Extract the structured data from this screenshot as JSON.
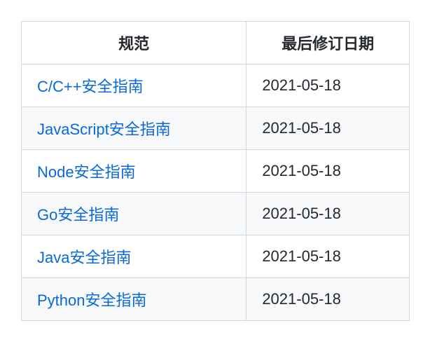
{
  "table": {
    "headers": {
      "spec": "规范",
      "date": "最后修订日期"
    },
    "rows": [
      {
        "name": "C/C++安全指南",
        "date": "2021-05-18"
      },
      {
        "name": "JavaScript安全指南",
        "date": "2021-05-18"
      },
      {
        "name": "Node安全指南",
        "date": "2021-05-18"
      },
      {
        "name": "Go安全指南",
        "date": "2021-05-18"
      },
      {
        "name": "Java安全指南",
        "date": "2021-05-18"
      },
      {
        "name": "Python安全指南",
        "date": "2021-05-18"
      }
    ]
  }
}
